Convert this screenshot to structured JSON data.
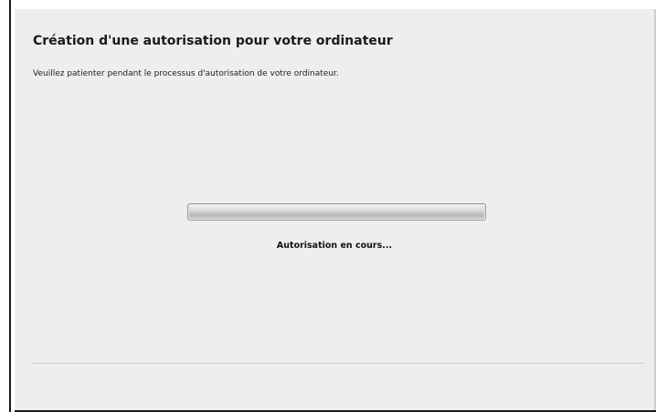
{
  "dialog": {
    "title": "Création d'une autorisation pour votre ordinateur",
    "description": "Veuillez patienter pendant le processus d'autorisation de votre ordinateur."
  },
  "progress": {
    "value": 1.0,
    "status_text": "Autorisation en cours..."
  }
}
